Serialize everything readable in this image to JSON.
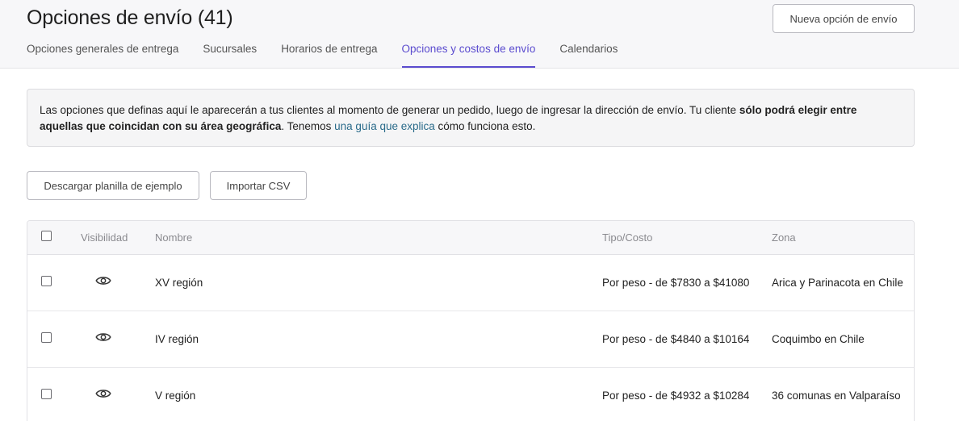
{
  "header": {
    "title": "Opciones de envío (41)",
    "new_button_label": "Nueva opción de envío"
  },
  "tabs": [
    {
      "label": "Opciones generales de entrega",
      "active": false
    },
    {
      "label": "Sucursales",
      "active": false
    },
    {
      "label": "Horarios de entrega",
      "active": false
    },
    {
      "label": "Opciones y costos de envío",
      "active": true
    },
    {
      "label": "Calendarios",
      "active": false
    }
  ],
  "info": {
    "text_1": "Las opciones que definas aquí le aparecerán a tus clientes al momento de generar un pedido, luego de ingresar la dirección de envío. Tu cliente ",
    "bold": "sólo podrá elegir entre aquellas que coincidan con su área geográfica",
    "text_2": ". Tenemos ",
    "link": "una guía que explica",
    "text_3": " cómo funciona esto."
  },
  "actions": {
    "template_label": "Descargar planilla de ejemplo",
    "import_label": "Importar CSV"
  },
  "table": {
    "columns": {
      "visibility": "Visibilidad",
      "name": "Nombre",
      "type_cost": "Tipo/Costo",
      "zone": "Zona"
    },
    "rows": [
      {
        "name": "XV región",
        "type_cost": "Por peso - de $7830 a $41080",
        "zone": "Arica y Parinacota en Chile"
      },
      {
        "name": "IV región",
        "type_cost": "Por peso - de $4840 a $10164",
        "zone": "Coquimbo en Chile"
      },
      {
        "name": "V región",
        "type_cost": "Por peso - de $4932 a $10284",
        "zone": "36 comunas en Valparaíso"
      }
    ]
  },
  "colors": {
    "accent": "#5b4ccf",
    "link": "#2a6b8a",
    "header_bg": "#f7f7f9"
  }
}
